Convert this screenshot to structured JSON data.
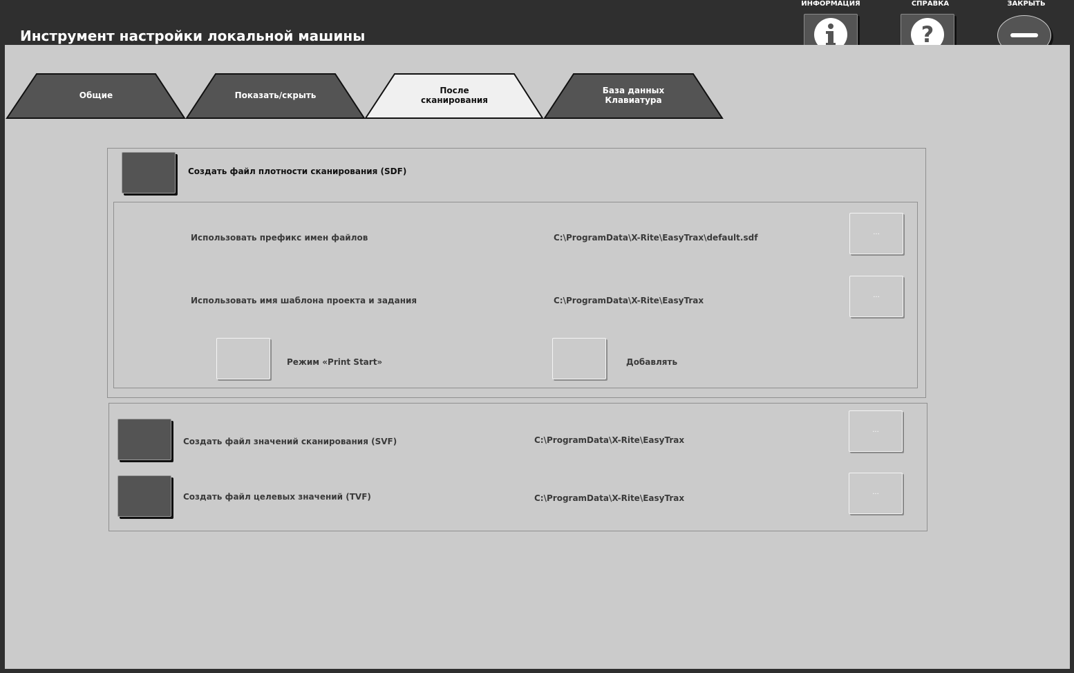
{
  "app": {
    "title": "Инструмент настройки локальной машины"
  },
  "top_buttons": {
    "info_label": "ИНФОРМАЦИЯ",
    "help_label": "СПРАВКА",
    "close_label": "ЗАКРЫТЬ"
  },
  "tabs": [
    {
      "label": "Общие",
      "active": false
    },
    {
      "label": "Показать/скрыть",
      "active": false
    },
    {
      "label": "После\nсканирования",
      "active": true
    },
    {
      "label": "База данных\nКлавиатура",
      "active": false
    }
  ],
  "sdf": {
    "checkbox_label": "Создать файл плотности сканирования (SDF)",
    "checked": false,
    "prefix_label": "Использовать префикс имен файлов",
    "prefix_path": "C:\\ProgramData\\X-Rite\\EasyTrax\\default.sdf",
    "template_label": "Использовать имя шаблона проекта и задания",
    "template_path": "C:\\ProgramData\\X-Rite\\EasyTrax",
    "print_start_label": "Режим «Print Start»",
    "append_label": "Добавлять",
    "browse_label": "..."
  },
  "svf": {
    "checkbox_label": "Создать файл значений сканирования (SVF)",
    "path": "C:\\ProgramData\\X-Rite\\EasyTrax",
    "browse_label": "..."
  },
  "tvf": {
    "checkbox_label": "Создать файл целевых значений (TVF)",
    "path": "C:\\ProgramData\\X-Rite\\EasyTrax",
    "browse_label": "..."
  },
  "colors": {
    "header_bg": "#2f2f2f",
    "content_bg": "#cbcbcb",
    "tab_inactive": "#545454",
    "tab_active": "#f0f0f0"
  }
}
